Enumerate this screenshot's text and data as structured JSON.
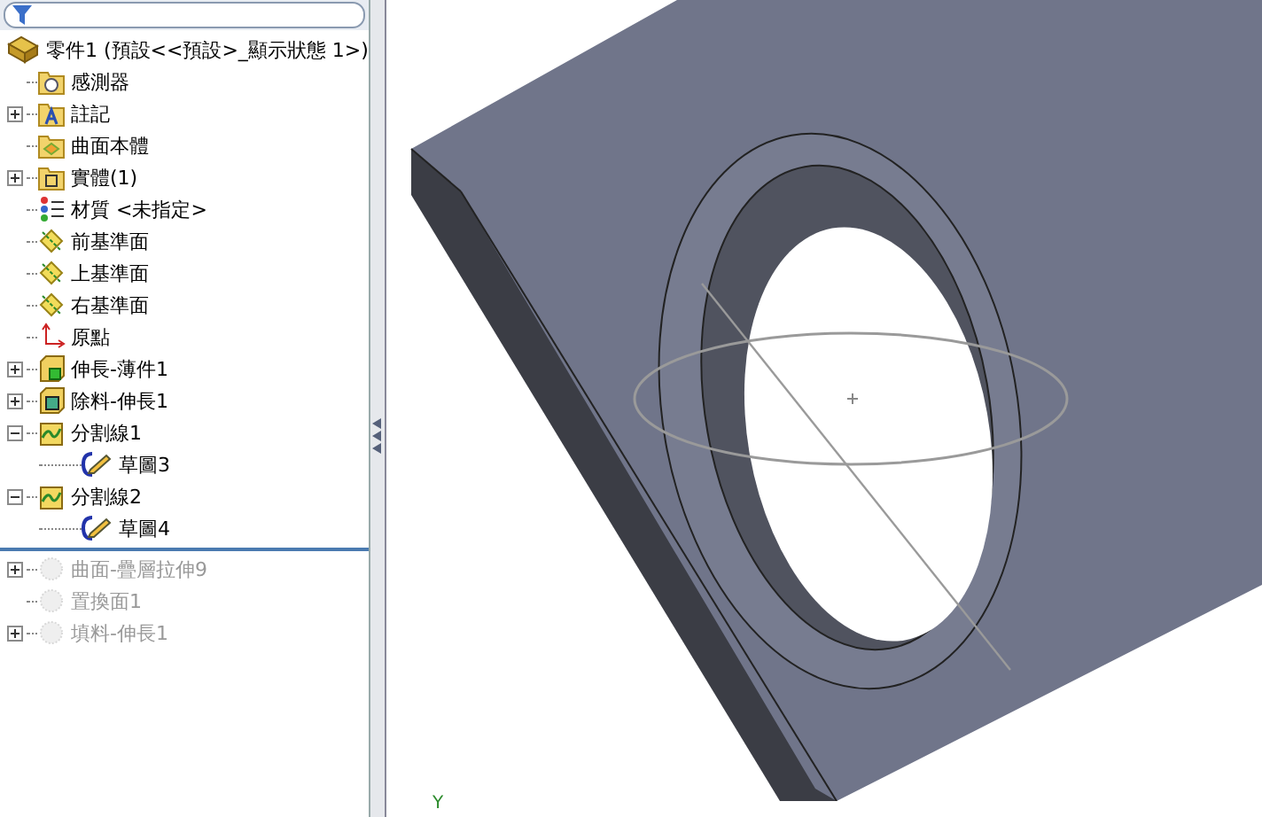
{
  "tree": {
    "root": {
      "label": "零件1  (預設<<預設>_顯示狀態 1>)"
    },
    "items": [
      {
        "label": "感測器",
        "kind": "sensor-folder",
        "rolled_back": false
      },
      {
        "label": "註記",
        "kind": "annotation-folder",
        "expanded": false,
        "rolled_back": false
      },
      {
        "label": "曲面本體",
        "kind": "surface-folder",
        "rolled_back": false
      },
      {
        "label": "實體(1)",
        "kind": "solid-folder",
        "expanded": false,
        "rolled_back": false
      },
      {
        "label": "材質 <未指定>",
        "kind": "material",
        "rolled_back": false
      },
      {
        "label": "前基準面",
        "kind": "plane",
        "rolled_back": false
      },
      {
        "label": "上基準面",
        "kind": "plane",
        "rolled_back": false
      },
      {
        "label": "右基準面",
        "kind": "plane",
        "rolled_back": false
      },
      {
        "label": "原點",
        "kind": "origin",
        "rolled_back": false
      },
      {
        "label": "伸長-薄件1",
        "kind": "extrude",
        "expanded": false,
        "rolled_back": false
      },
      {
        "label": "除料-伸長1",
        "kind": "cut",
        "expanded": false,
        "rolled_back": false
      },
      {
        "label": "分割線1",
        "kind": "split",
        "expanded": true,
        "rolled_back": false,
        "children": [
          {
            "label": "草圖3",
            "kind": "sketch"
          }
        ]
      },
      {
        "label": "分割線2",
        "kind": "split",
        "expanded": true,
        "rolled_back": false,
        "children": [
          {
            "label": "草圖4",
            "kind": "sketch"
          }
        ]
      },
      {
        "label": "曲面-疊層拉伸9",
        "kind": "loft",
        "expanded": false,
        "rolled_back": true
      },
      {
        "label": "置換面1",
        "kind": "replace",
        "rolled_back": true
      },
      {
        "label": "填料-伸長1",
        "kind": "boss",
        "expanded": false,
        "rolled_back": true
      }
    ]
  },
  "viewport": {
    "triad_label": "Y"
  }
}
